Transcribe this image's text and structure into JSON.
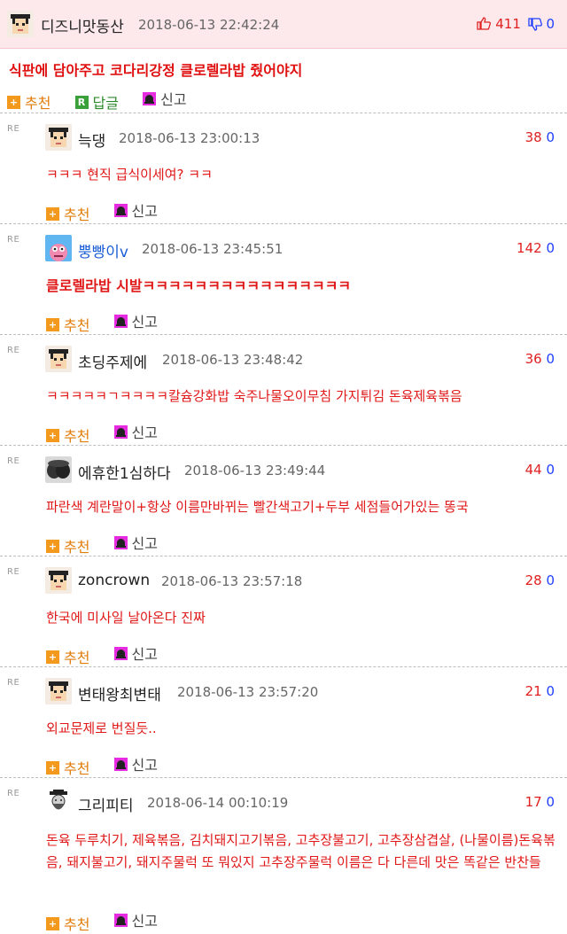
{
  "post": {
    "author": "디즈니맛동산",
    "datetime": "2018-06-13 22:42:24",
    "up_votes": "411",
    "down_votes": "0",
    "title": "식판에 담아주고 코다리강정 클로렐라밥 줬어야지",
    "actions": {
      "recommend": "추천",
      "reply": "답글",
      "report": "신고"
    }
  },
  "comments": [
    {
      "re": "RE",
      "author": "늑댕",
      "datetime": "2018-06-13 23:00:13",
      "up": "38",
      "down": "0",
      "text": "ㅋㅋㅋ 현직 급식이세여? ㅋㅋ",
      "recommend": "추천",
      "report": "신고"
    },
    {
      "re": "RE",
      "author": "뿡빵이v",
      "datetime": "2018-06-13 23:45:51",
      "up": "142",
      "down": "0",
      "text": "클로렐라밥 시발ㅋㅋㅋㅋㅋㅋㅋㅋㅋㅋㅋㅋㅋㅋㅋㅋ",
      "recommend": "추천",
      "report": "신고"
    },
    {
      "re": "RE",
      "author": "초딩주제에",
      "datetime": "2018-06-13 23:48:42",
      "up": "36",
      "down": "0",
      "text": "ㅋㅋㅋㅋㅋㄱㅋㅋㅋㅋ칼슘강화밥 숙주나물오이무침 가지튀김 돈육제육볶음",
      "recommend": "추천",
      "report": "신고"
    },
    {
      "re": "RE",
      "author": "에휴한1심하다",
      "datetime": "2018-06-13 23:49:44",
      "up": "44",
      "down": "0",
      "text": "파란색 계란말이+항상 이름만바뀌는 빨간색고기+두부 세점들어가있는 똥국",
      "recommend": "추천",
      "report": "신고"
    },
    {
      "re": "RE",
      "author": "zoncrown",
      "datetime": "2018-06-13 23:57:18",
      "up": "28",
      "down": "0",
      "text": "한국에 미사일 날아온다 진짜",
      "recommend": "추천",
      "report": "신고"
    },
    {
      "re": "RE",
      "author": "변태왕최변태",
      "datetime": "2018-06-13 23:57:20",
      "up": "21",
      "down": "0",
      "text": "외교문제로 번질듯..",
      "recommend": "추천",
      "report": "신고"
    },
    {
      "re": "RE",
      "author": "그리피티",
      "datetime": "2018-06-14 00:10:19",
      "up": "17",
      "down": "0",
      "text": "돈육 두루치기, 제육볶음, 김치돼지고기볶음, 고추장불고기, 고추장삼겹살, (나물이름)돈육볶음, 돼지불고기, 돼지주물럭 또 뭐있지 고추장주물럭 이름은 다 다른데 맛은 똑같은 반찬들",
      "recommend": "추천",
      "report": "신고"
    }
  ],
  "colors": {
    "accent_red": "#e01818",
    "down_blue": "#2040ff",
    "header_bg": "#fde8ec",
    "recommend_orange": "#f39a1e",
    "report_magenta": "#e62be0"
  }
}
